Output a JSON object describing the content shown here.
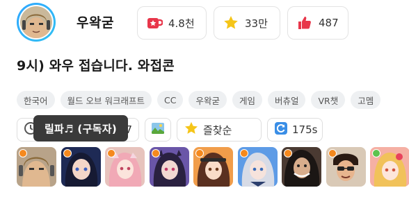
{
  "channel": {
    "name": "우왁굳",
    "stats": [
      {
        "icon": "mug-icon",
        "value": "4.8천",
        "color": "#e8364a"
      },
      {
        "icon": "star-icon",
        "value": "33만",
        "color": "#f5c518"
      },
      {
        "icon": "thumbs-up-icon",
        "value": "487",
        "color": "#e8364a"
      }
    ]
  },
  "stream": {
    "title": "9시) 와우 접습니다. 와접콘",
    "tags": [
      "한국어",
      "월드 오브 워크래프트",
      "CC",
      "우왁굳",
      "게임",
      "버츄얼",
      "VR챗",
      "고멤"
    ]
  },
  "actions": {
    "timer_partial": "27",
    "sort_label": "즐찾순",
    "refresh_label": "175s",
    "tooltip": "릴파♬ (구독자)"
  },
  "members": [
    {
      "status": "orange",
      "bg": "#b8a389"
    },
    {
      "status": "orange",
      "bg": "#1e2a55"
    },
    {
      "status": "orange",
      "bg": "#e7c3bd"
    },
    {
      "status": "orange",
      "bg": "#6a56a8"
    },
    {
      "status": "orange",
      "bg": "#f19d4a"
    },
    {
      "status": "orange",
      "bg": "#5d9be6"
    },
    {
      "status": "orange",
      "bg": "#4a3a32"
    },
    {
      "status": "orange",
      "bg": "#d9c9b6"
    },
    {
      "status": "green",
      "bg": "#f5b0a4"
    }
  ],
  "colors": {
    "accent": "#2ea6ff",
    "tag_bg": "#eef0f2",
    "tooltip_bg": "#3a3a3a"
  }
}
